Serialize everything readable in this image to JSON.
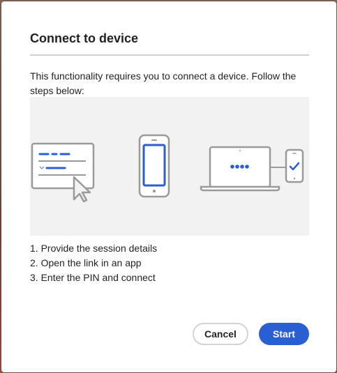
{
  "dialog": {
    "title": "Connect to device",
    "description": "This functionality requires you to connect a device. Follow the steps below:",
    "steps": [
      "1. Provide the session details",
      "2. Open the link in an app",
      "3. Enter the PIN and connect"
    ],
    "cancel_label": "Cancel",
    "start_label": "Start"
  },
  "colors": {
    "accent": "#2a5fd3",
    "icon_gray": "#9a9a9a",
    "illustration_bg": "#f2f2f2"
  },
  "icons": [
    "session-form-icon",
    "cursor-icon",
    "phone-icon",
    "laptop-icon",
    "pin-dots-icon",
    "phone-check-icon",
    "checkmark-icon"
  ]
}
